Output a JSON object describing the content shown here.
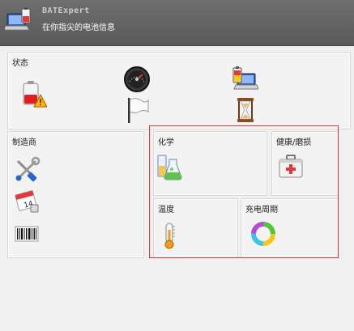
{
  "app": {
    "title": "BATExpert",
    "subtitle": "在你指尖的电池信息"
  },
  "status_panel": {
    "title": "状态",
    "tiles": [
      "battery-warning-icon",
      "gauge-icon",
      "laptop-battery-icon",
      "white-flag-icon",
      "hourglass-icon"
    ]
  },
  "manufacturer_panel": {
    "title": "制造商",
    "tiles": [
      "tools-icon",
      "calendar-icon",
      "barcode-icon"
    ]
  },
  "chemistry_panel": {
    "title": "化学",
    "icon": "chemistry-flask-icon"
  },
  "health_panel": {
    "title": "健康/磨损",
    "icon": "first-aid-kit-icon"
  },
  "temperature_panel": {
    "title": "温度",
    "icon": "thermometer-icon"
  },
  "cycles_panel": {
    "title": "充电周期",
    "icon": "charge-cycle-ring-icon"
  },
  "colors": {
    "highlight_border": "#e53030",
    "header_bg": "#636363"
  }
}
